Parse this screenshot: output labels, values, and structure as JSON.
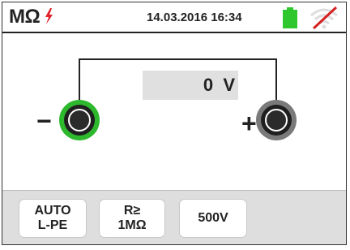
{
  "header": {
    "mode": "MΩ",
    "datetime": "14.03.2016  16:34"
  },
  "measurement": {
    "value": "0",
    "unit": "V"
  },
  "terminals": {
    "negative_sign": "−",
    "positive_sign": "+"
  },
  "buttons": [
    {
      "line1": "AUTO",
      "line2": "L-PE"
    },
    {
      "line1": "R≥",
      "line2": "1MΩ"
    },
    {
      "line1": "500V",
      "line2": ""
    }
  ],
  "colors": {
    "battery": "#2ec82e",
    "neg_terminal_ring": "#2eb82e",
    "wifi_slash": "#d42020",
    "bolt": "#e0202a"
  },
  "icons": {
    "bolt": "lightning-bolt-icon",
    "battery": "battery-icon",
    "wifi": "wifi-disabled-icon"
  }
}
